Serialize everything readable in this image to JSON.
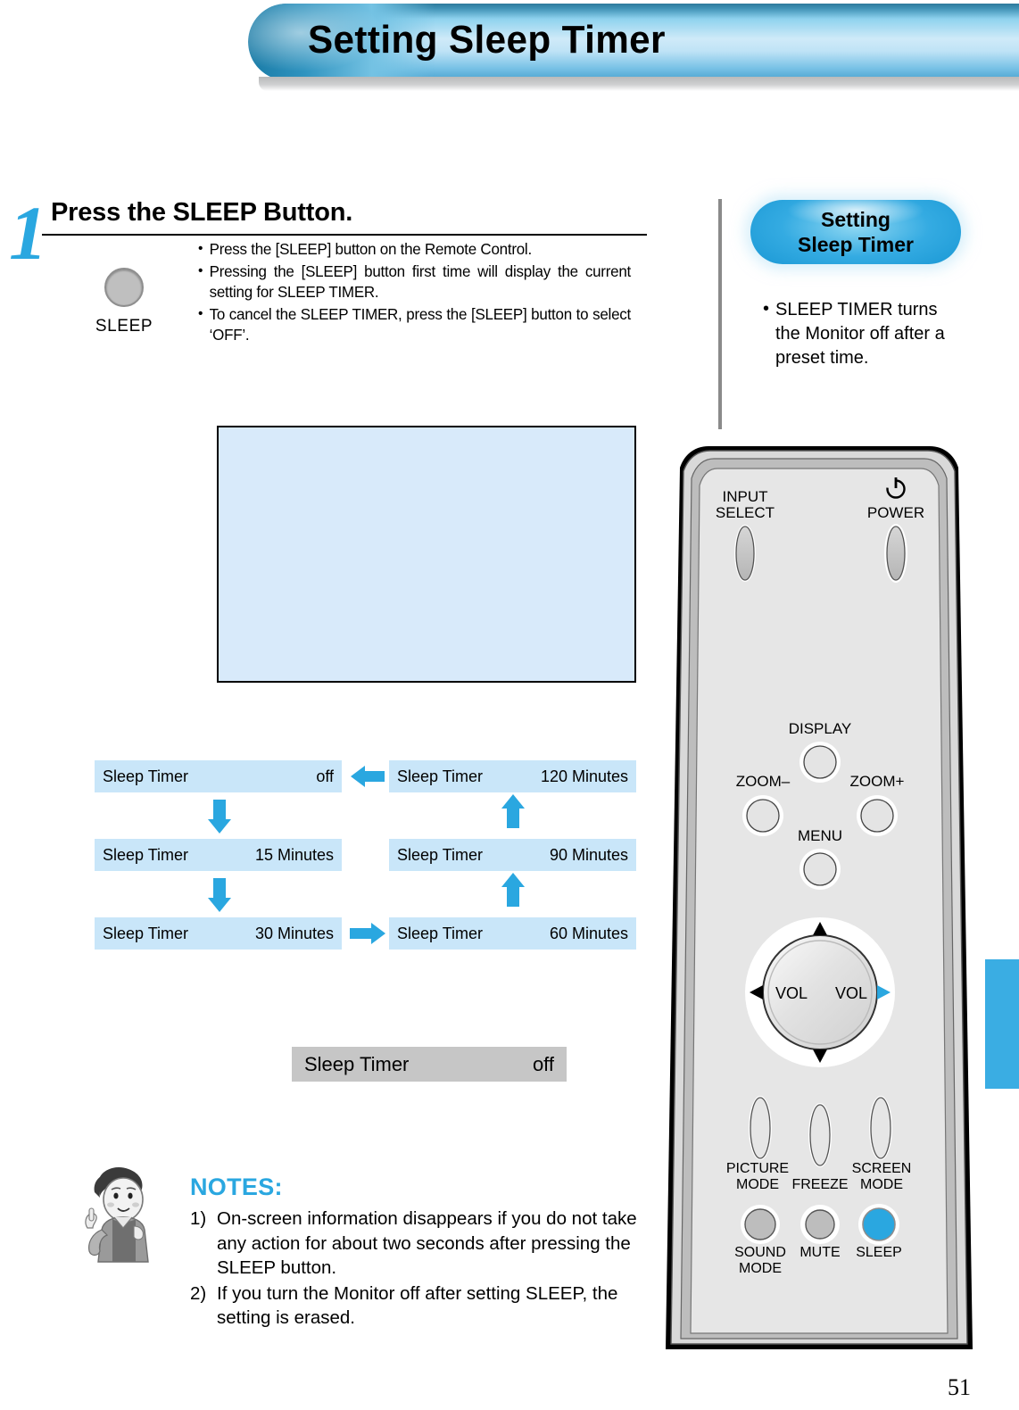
{
  "header": {
    "title": "Setting Sleep Timer"
  },
  "step": {
    "number": "1",
    "title": "Press the SLEEP Button.",
    "key_label": "SLEEP",
    "bullets": [
      "Press the [SLEEP] button on the Remote Control.",
      "Pressing the [SLEEP] button first time will display the current setting for SLEEP TIMER.",
      "To cancel the SLEEP TIMER, press the [SLEEP] button to select ‘OFF’."
    ]
  },
  "sidebar": {
    "badge_line1": "Setting",
    "badge_line2": "Sleep Timer",
    "note": "SLEEP TIMER turns the Monitor off after a preset time."
  },
  "osd": {
    "label": "Sleep Timer",
    "value": "off"
  },
  "chart_data": {
    "type": "diagram",
    "title": "Sleep Timer cycle",
    "nodes": [
      {
        "id": "off",
        "label": "Sleep Timer",
        "value": "off",
        "col": "left",
        "row": 1
      },
      {
        "id": "m15",
        "label": "Sleep Timer",
        "value": "15 Minutes",
        "col": "left",
        "row": 2
      },
      {
        "id": "m30",
        "label": "Sleep Timer",
        "value": "30 Minutes",
        "col": "left",
        "row": 3
      },
      {
        "id": "m60",
        "label": "Sleep Timer",
        "value": "60 Minutes",
        "col": "right",
        "row": 3
      },
      {
        "id": "m90",
        "label": "Sleep Timer",
        "value": "90 Minutes",
        "col": "right",
        "row": 2
      },
      {
        "id": "m120",
        "label": "Sleep Timer",
        "value": "120 Minutes",
        "col": "right",
        "row": 1
      }
    ],
    "edges": [
      {
        "from": "off",
        "to": "m15",
        "direction": "down"
      },
      {
        "from": "m15",
        "to": "m30",
        "direction": "down"
      },
      {
        "from": "m30",
        "to": "m60",
        "direction": "right"
      },
      {
        "from": "m60",
        "to": "m90",
        "direction": "up"
      },
      {
        "from": "m90",
        "to": "m120",
        "direction": "up"
      },
      {
        "from": "m120",
        "to": "off",
        "direction": "left"
      }
    ],
    "accent_color": "#2aa7e0",
    "cell_color": "#c9e6f9"
  },
  "notes": {
    "title": "NOTES:",
    "items": [
      {
        "num": "1)",
        "text": "On-screen information disappears if you do not take any action for about two seconds after pressing the SLEEP button."
      },
      {
        "num": "2)",
        "text": "If you turn the Monitor off after setting SLEEP, the setting is erased."
      }
    ]
  },
  "remote": {
    "buttons": {
      "input_select_line1": "INPUT",
      "input_select_line2": "SELECT",
      "power": "POWER",
      "display": "DISPLAY",
      "zoom_minus": "ZOOM–",
      "zoom_plus": "ZOOM+",
      "menu": "MENU",
      "vol_left": "VOL",
      "vol_right": "VOL",
      "picture_mode_line1": "PICTURE",
      "picture_mode_line2": "MODE",
      "freeze": "FREEZE",
      "screen_mode_line1": "SCREEN",
      "screen_mode_line2": "MODE",
      "sound_mode_line1": "SOUND",
      "sound_mode_line2": "MODE",
      "mute": "MUTE",
      "sleep": "SLEEP"
    },
    "highlight_color": "#2aa7e0"
  },
  "page": {
    "number": "51"
  }
}
